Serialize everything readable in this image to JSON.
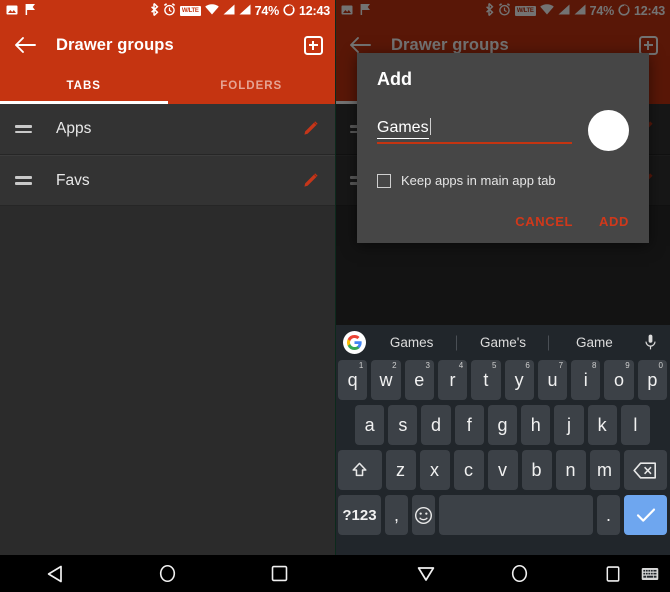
{
  "status_bar": {
    "icons_left": [
      "image-icon",
      "flag-icon"
    ],
    "icons_right": [
      "bluetooth-icon",
      "alarm-icon",
      "wifi-lte-badge",
      "wifi-icon",
      "signal-icon",
      "signal-icon-2"
    ],
    "lte_label": "W/LTE",
    "battery": "74%",
    "time": "12:43"
  },
  "toolbar": {
    "back_icon": "back-arrow-icon",
    "title": "Drawer groups",
    "add_icon": "add-icon"
  },
  "tabs": [
    {
      "label": "TABS",
      "active": true
    },
    {
      "label": "FOLDERS",
      "active": false
    }
  ],
  "list": {
    "rows": [
      {
        "label": "Apps",
        "drag_icon": "drag-handle-icon",
        "edit_icon": "pencil-icon"
      },
      {
        "label": "Favs",
        "drag_icon": "drag-handle-icon",
        "edit_icon": "pencil-icon"
      }
    ]
  },
  "dialog": {
    "title": "Add",
    "input_value": "Games",
    "color_swatch": "#ffffff",
    "checkbox_label": "Keep apps in main app tab",
    "checkbox_checked": false,
    "cancel_label": "CANCEL",
    "confirm_label": "ADD"
  },
  "keyboard": {
    "suggestions": [
      "Games",
      "Game's",
      "Game"
    ],
    "google_logo": "G",
    "mic_icon": "microphone-icon",
    "row1": [
      {
        "k": "q",
        "n": "1"
      },
      {
        "k": "w",
        "n": "2"
      },
      {
        "k": "e",
        "n": "3"
      },
      {
        "k": "r",
        "n": "4"
      },
      {
        "k": "t",
        "n": "5"
      },
      {
        "k": "y",
        "n": "6"
      },
      {
        "k": "u",
        "n": "7"
      },
      {
        "k": "i",
        "n": "8"
      },
      {
        "k": "o",
        "n": "9"
      },
      {
        "k": "p",
        "n": "0"
      }
    ],
    "row2": [
      "a",
      "s",
      "d",
      "f",
      "g",
      "h",
      "j",
      "k",
      "l"
    ],
    "row3_letters": [
      "z",
      "x",
      "c",
      "v",
      "b",
      "n",
      "m"
    ],
    "shift_icon": "shift-icon",
    "backspace_icon": "backspace-icon",
    "symbols_label": "?123",
    "comma": ",",
    "emoji_icon": "emoji-icon",
    "period": ".",
    "enter_icon": "checkmark-icon"
  },
  "navbar": {
    "left": [
      "back-triangle-icon",
      "home-circle-icon",
      "recents-square-icon"
    ],
    "right": [
      "keyboard-down-icon",
      "home-circle-icon",
      "recents-square-icon",
      "keyboard-switch-icon"
    ]
  },
  "colors": {
    "accent": "#c53411",
    "dialog_bg": "#464646",
    "surface": "#333333",
    "background": "#2b2b2b",
    "keyboard_bg": "#21262b",
    "enter_key": "#6ea6ef"
  }
}
